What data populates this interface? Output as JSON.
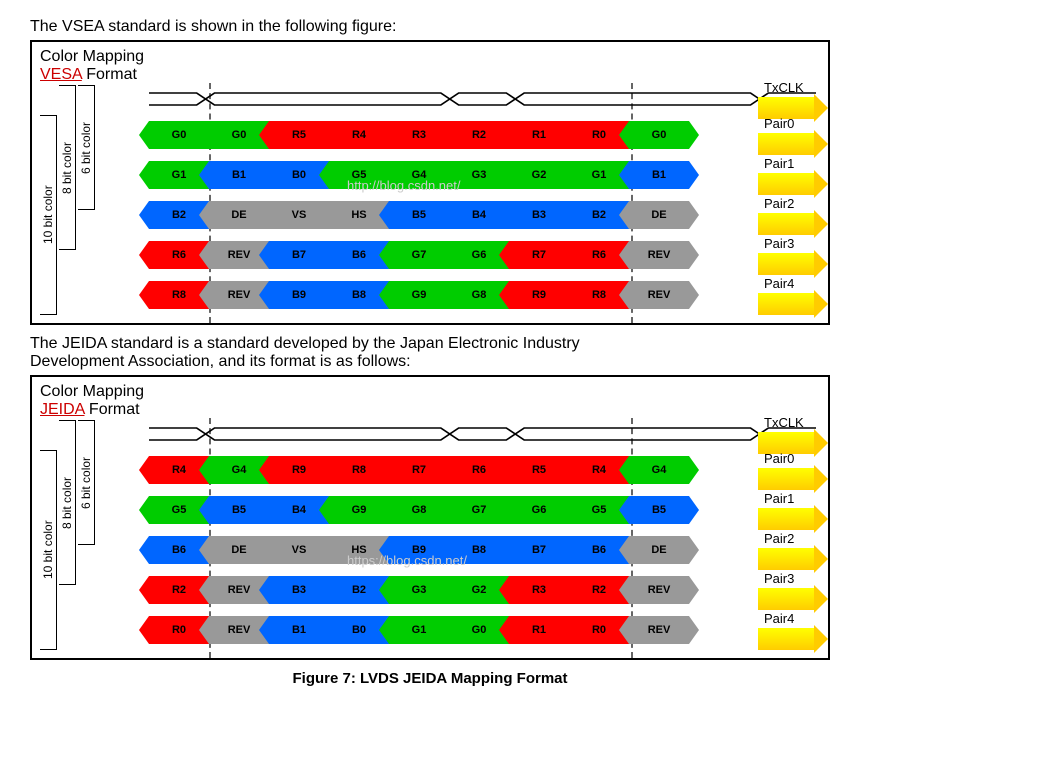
{
  "chart_data": [
    {
      "type": "table",
      "format": "VESA",
      "title": "Color Mapping VESA Format",
      "clock": "TxCLK",
      "bit_depth_labels": [
        "10 bit color",
        "8 bit color",
        "6 bit color"
      ],
      "pairs": [
        {
          "name": "Pair0",
          "slots": [
            "G0",
            "G0",
            "R5",
            "R4",
            "R3",
            "R2",
            "R1",
            "R0",
            "G0"
          ]
        },
        {
          "name": "Pair1",
          "slots": [
            "G1",
            "B1",
            "B0",
            "G5",
            "G4",
            "G3",
            "G2",
            "G1",
            "B1"
          ]
        },
        {
          "name": "Pair2",
          "slots": [
            "B2",
            "DE",
            "VS",
            "HS",
            "B5",
            "B4",
            "B3",
            "B2",
            "DE"
          ]
        },
        {
          "name": "Pair3",
          "slots": [
            "R6",
            "REV",
            "B7",
            "B6",
            "G7",
            "G6",
            "R7",
            "R6",
            "REV"
          ]
        },
        {
          "name": "Pair4",
          "slots": [
            "R8",
            "REV",
            "B9",
            "B8",
            "G9",
            "G8",
            "R9",
            "R8",
            "REV"
          ]
        }
      ]
    },
    {
      "type": "table",
      "format": "JEIDA",
      "title": "Color Mapping JEIDA Format",
      "clock": "TxCLK",
      "bit_depth_labels": [
        "10 bit color",
        "8 bit color",
        "6 bit color"
      ],
      "pairs": [
        {
          "name": "Pair0",
          "slots": [
            "R4",
            "G4",
            "R9",
            "R8",
            "R7",
            "R6",
            "R5",
            "R4",
            "G4"
          ]
        },
        {
          "name": "Pair1",
          "slots": [
            "G5",
            "B5",
            "B4",
            "G9",
            "G8",
            "G7",
            "G6",
            "G5",
            "B5"
          ]
        },
        {
          "name": "Pair2",
          "slots": [
            "B6",
            "DE",
            "VS",
            "HS",
            "B9",
            "B8",
            "B7",
            "B6",
            "DE"
          ]
        },
        {
          "name": "Pair3",
          "slots": [
            "R2",
            "REV",
            "B3",
            "B2",
            "G3",
            "G2",
            "R3",
            "R2",
            "REV"
          ]
        },
        {
          "name": "Pair4",
          "slots": [
            "R0",
            "REV",
            "B1",
            "B0",
            "G1",
            "G0",
            "R1",
            "R0",
            "REV"
          ]
        }
      ]
    }
  ],
  "captions": {
    "vsea_intro": "The VSEA standard is shown in the following figure:",
    "jeida_intro1": "The JEIDA standard is a standard developed by the Japan Electronic Industry",
    "jeida_intro2": " Development Association, and its format is as follows:",
    "figure7": "Figure 7: LVDS JEIDA Mapping Format"
  },
  "labels": {
    "color_mapping": "Color Mapping",
    "vesa": "VESA",
    "jeida": "JEIDA",
    "format": " Format",
    "l10": "10 bit color",
    "l8": "8 bit color",
    "l6": "6 bit color",
    "txclk": "TxCLK",
    "pair0": "Pair0",
    "pair1": "Pair1",
    "pair2": "Pair2",
    "pair3": "Pair3",
    "pair4": "Pair4",
    "wm1": "http://blog.csdn.net/",
    "wm2": "https://blog.csdn.net/"
  },
  "vesa": {
    "p0": {
      "s0": "G0",
      "s1": "G0",
      "s2": "R5",
      "s3": "R4",
      "s4": "R3",
      "s5": "R2",
      "s6": "R1",
      "s7": "R0",
      "s8": "G0"
    },
    "p1": {
      "s0": "G1",
      "s1": "B1",
      "s2": "B0",
      "s3": "G5",
      "s4": "G4",
      "s5": "G3",
      "s6": "G2",
      "s7": "G1",
      "s8": "B1"
    },
    "p2": {
      "s0": "B2",
      "s1": "DE",
      "s2": "VS",
      "s3": "HS",
      "s4": "B5",
      "s5": "B4",
      "s6": "B3",
      "s7": "B2",
      "s8": "DE"
    },
    "p3": {
      "s0": "R6",
      "s1": "REV",
      "s2": "B7",
      "s3": "B6",
      "s4": "G7",
      "s5": "G6",
      "s6": "R7",
      "s7": "R6",
      "s8": "REV"
    },
    "p4": {
      "s0": "R8",
      "s1": "REV",
      "s2": "B9",
      "s3": "B8",
      "s4": "G9",
      "s5": "G8",
      "s6": "R9",
      "s7": "R8",
      "s8": "REV"
    }
  },
  "jeida": {
    "p0": {
      "s0": "R4",
      "s1": "G4",
      "s2": "R9",
      "s3": "R8",
      "s4": "R7",
      "s5": "R6",
      "s6": "R5",
      "s7": "R4",
      "s8": "G4"
    },
    "p1": {
      "s0": "G5",
      "s1": "B5",
      "s2": "B4",
      "s3": "G9",
      "s4": "G8",
      "s5": "G7",
      "s6": "G6",
      "s7": "G5",
      "s8": "B5"
    },
    "p2": {
      "s0": "B6",
      "s1": "DE",
      "s2": "VS",
      "s3": "HS",
      "s4": "B9",
      "s5": "B8",
      "s6": "B7",
      "s7": "B6",
      "s8": "DE"
    },
    "p3": {
      "s0": "R2",
      "s1": "REV",
      "s2": "B3",
      "s3": "B2",
      "s4": "G3",
      "s5": "G2",
      "s6": "R3",
      "s7": "R2",
      "s8": "REV"
    },
    "p4": {
      "s0": "R0",
      "s1": "REV",
      "s2": "B1",
      "s3": "B0",
      "s4": "G1",
      "s5": "G0",
      "s6": "R1",
      "s7": "R0",
      "s8": "REV"
    }
  }
}
